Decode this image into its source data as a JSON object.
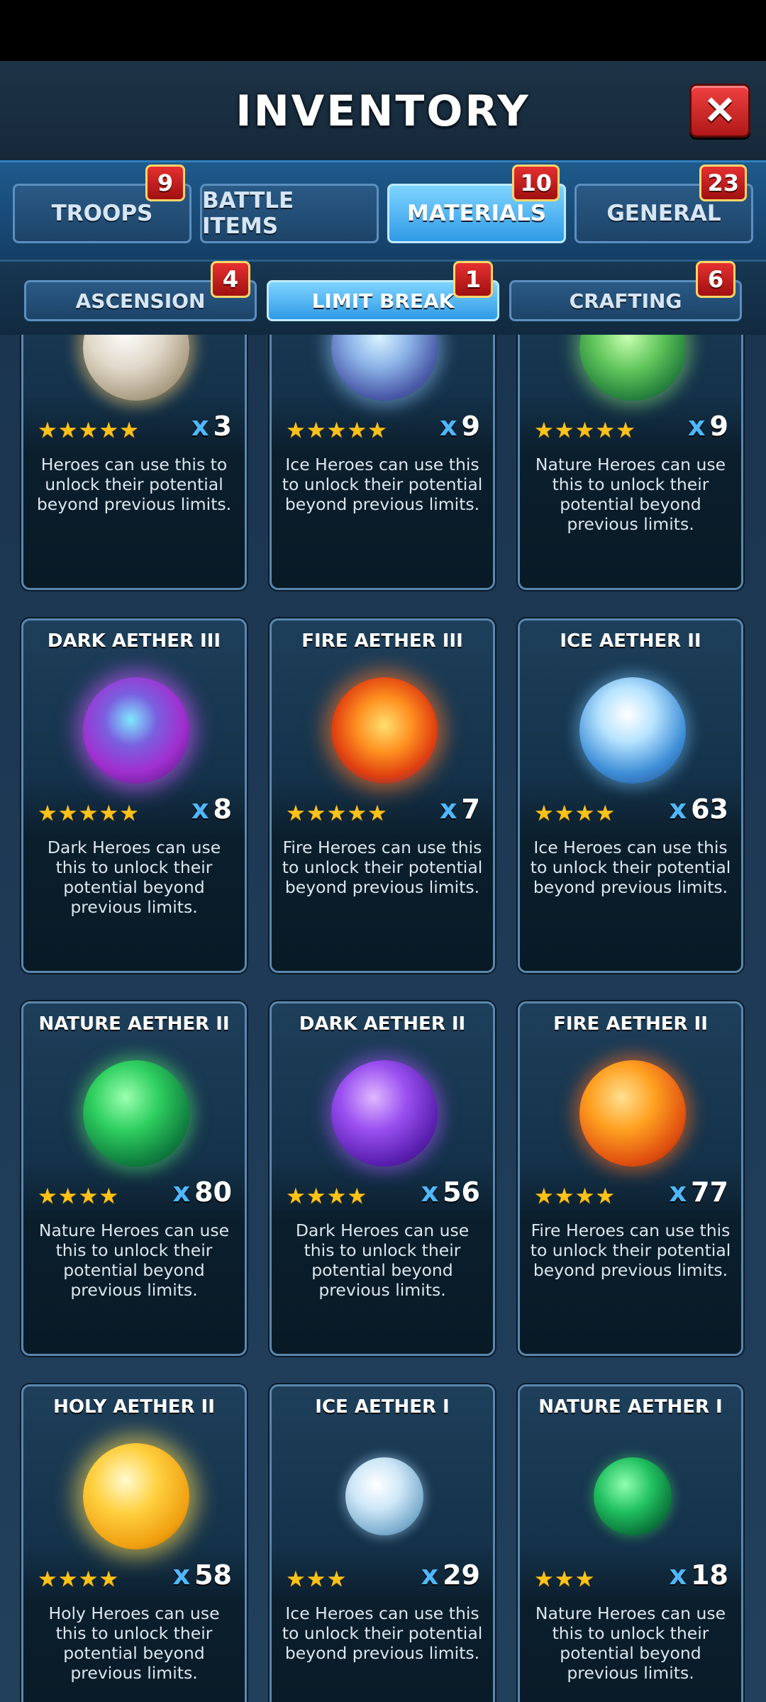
{
  "header": {
    "title": "INVENTORY",
    "close_label": "✕"
  },
  "tabs": [
    {
      "label": "TROOPS",
      "badge": "9",
      "active": false
    },
    {
      "label": "BATTLE ITEMS",
      "badge": "",
      "active": false
    },
    {
      "label": "MATERIALS",
      "badge": "10",
      "active": true
    },
    {
      "label": "GENERAL",
      "badge": "23",
      "active": false
    }
  ],
  "subtabs": [
    {
      "label": "ASCENSION",
      "badge": "4",
      "active": false
    },
    {
      "label": "LIMIT BREAK",
      "badge": "1",
      "active": true
    },
    {
      "label": "CRAFTING",
      "badge": "6",
      "active": false
    }
  ],
  "items": [
    {
      "name": "",
      "stars": "★★★★★",
      "count": "3",
      "desc": "Heroes can use this to unlock their potential beyond previous limits.",
      "orb": "holy",
      "icon": "holy-aether-orb-icon"
    },
    {
      "name": "",
      "stars": "★★★★★",
      "count": "9",
      "desc": "Ice Heroes can use this to unlock their potential beyond previous limits.",
      "orb": "ice-light",
      "icon": "ice-aether-orb-icon"
    },
    {
      "name": "",
      "stars": "★★★★★",
      "count": "9",
      "desc": "Nature Heroes can use this to unlock their potential beyond previous limits.",
      "orb": "nature-light",
      "icon": "nature-aether-orb-icon"
    },
    {
      "name": "DARK AETHER III",
      "stars": "★★★★★",
      "count": "8",
      "desc": "Dark Heroes can use this to unlock their potential beyond previous limits.",
      "orb": "dark",
      "icon": "dark-aether-orb-icon"
    },
    {
      "name": "FIRE AETHER III",
      "stars": "★★★★★",
      "count": "7",
      "desc": "Fire Heroes can use this to unlock their potential beyond previous limits.",
      "orb": "fire",
      "icon": "fire-aether-orb-icon"
    },
    {
      "name": "ICE AETHER II",
      "stars": "★★★★",
      "count": "63",
      "desc": "Ice Heroes can use this to unlock their potential beyond previous limits.",
      "orb": "ice",
      "icon": "ice-aether-orb-icon"
    },
    {
      "name": "NATURE AETHER II",
      "stars": "★★★★",
      "count": "80",
      "desc": "Nature Heroes can use this to unlock their potential beyond previous limits.",
      "orb": "nature",
      "icon": "nature-aether-orb-icon"
    },
    {
      "name": "DARK AETHER II",
      "stars": "★★★★",
      "count": "56",
      "desc": "Dark Heroes can use this to unlock their potential beyond previous limits.",
      "orb": "dark2",
      "icon": "dark-aether-orb-icon"
    },
    {
      "name": "FIRE AETHER II",
      "stars": "★★★★",
      "count": "77",
      "desc": "Fire Heroes can use this to unlock their potential beyond previous limits.",
      "orb": "fire2",
      "icon": "fire-aether-orb-icon"
    },
    {
      "name": "HOLY AETHER II",
      "stars": "★★★★",
      "count": "58",
      "desc": "Holy Heroes can use this to unlock their potential beyond previous limits.",
      "orb": "holy2",
      "icon": "holy-aether-orb-icon"
    },
    {
      "name": "ICE AETHER I",
      "stars": "★★★",
      "count": "29",
      "desc": "Ice Heroes can use this to unlock their potential beyond previous limits.",
      "orb": "ice-s",
      "icon": "ice-aether-orb-icon"
    },
    {
      "name": "NATURE AETHER I",
      "stars": "★★★",
      "count": "18",
      "desc": "Nature Heroes can use this to unlock their potential beyond previous limits.",
      "orb": "nature-s",
      "icon": "nature-aether-orb-icon"
    }
  ],
  "count_prefix": "x",
  "colors": {
    "accent": "#4fb7ff",
    "star": "#ffc21a",
    "badge": "#e53030",
    "close": "#e03030"
  }
}
